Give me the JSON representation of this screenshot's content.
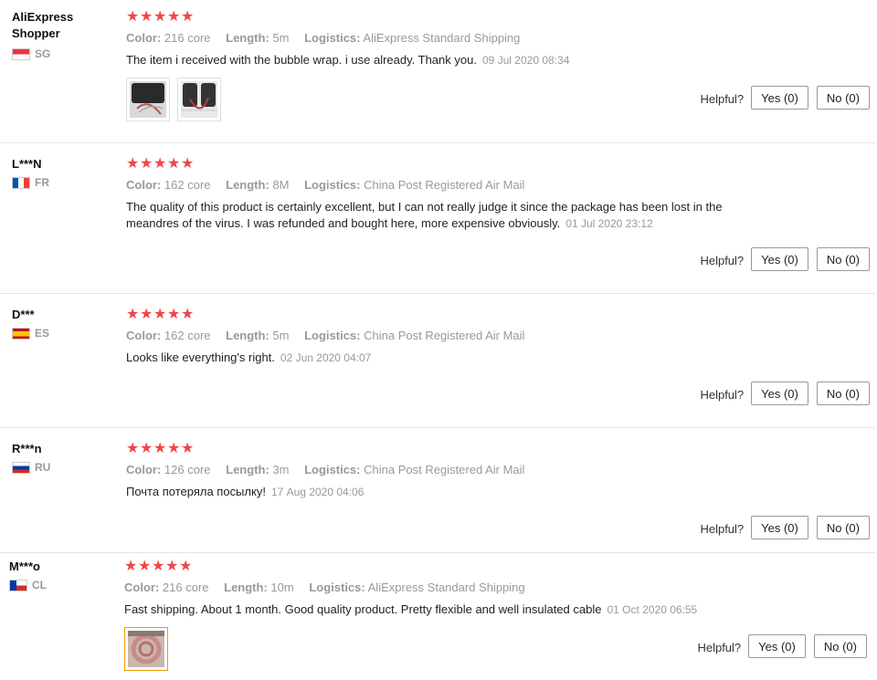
{
  "ui": {
    "helpful_label": "Helpful?",
    "color_label": "Color:",
    "length_label": "Length:",
    "logistics_label": "Logistics:",
    "star_glyph": "★"
  },
  "reviews": [
    {
      "user": "AliExpress Shopper",
      "country": "SG",
      "rating": 5,
      "color": "216 core",
      "length": "5m",
      "logistics": "AliExpress Standard Shipping",
      "text": "The item i received with the bubble wrap. i use already. Thank you.",
      "date": "09 Jul 2020 08:34",
      "yes": "Yes (0)",
      "no": "No (0)"
    },
    {
      "user": "L***N",
      "country": "FR",
      "rating": 5,
      "color": "162 core",
      "length": "8M",
      "logistics": "China Post Registered Air Mail",
      "text": "The quality of this product is certainly excellent, but I can not really judge it since the package has been lost in the meandres of the virus. I was refunded and bought here, more expensive obviously.",
      "date": "01 Jul 2020 23:12",
      "yes": "Yes (0)",
      "no": "No (0)"
    },
    {
      "user": "D***",
      "country": "ES",
      "rating": 5,
      "color": "162 core",
      "length": "5m",
      "logistics": "China Post Registered Air Mail",
      "text": "Looks like everything's right.",
      "date": "02 Jun 2020 04:07",
      "yes": "Yes (0)",
      "no": "No (0)"
    },
    {
      "user": "R***n",
      "country": "RU",
      "rating": 5,
      "color": "126 core",
      "length": "3m",
      "logistics": "China Post Registered Air Mail",
      "text": "Почта потеряла посылку!",
      "date": "17 Aug 2020 04:06",
      "yes": "Yes (0)",
      "no": "No (0)"
    },
    {
      "user": "M***o",
      "country": "CL",
      "rating": 5,
      "color": "216 core",
      "length": "10m",
      "logistics": "AliExpress Standard Shipping",
      "text": "Fast shipping. About 1 month. Good quality product. Pretty flexible and well insulated cable",
      "date": "01 Oct 2020 06:55",
      "yes": "Yes (0)",
      "no": "No (0)"
    }
  ],
  "colors": {
    "star": "#f04646",
    "muted": "#999999",
    "thumb_selected_border": "#f39800"
  }
}
